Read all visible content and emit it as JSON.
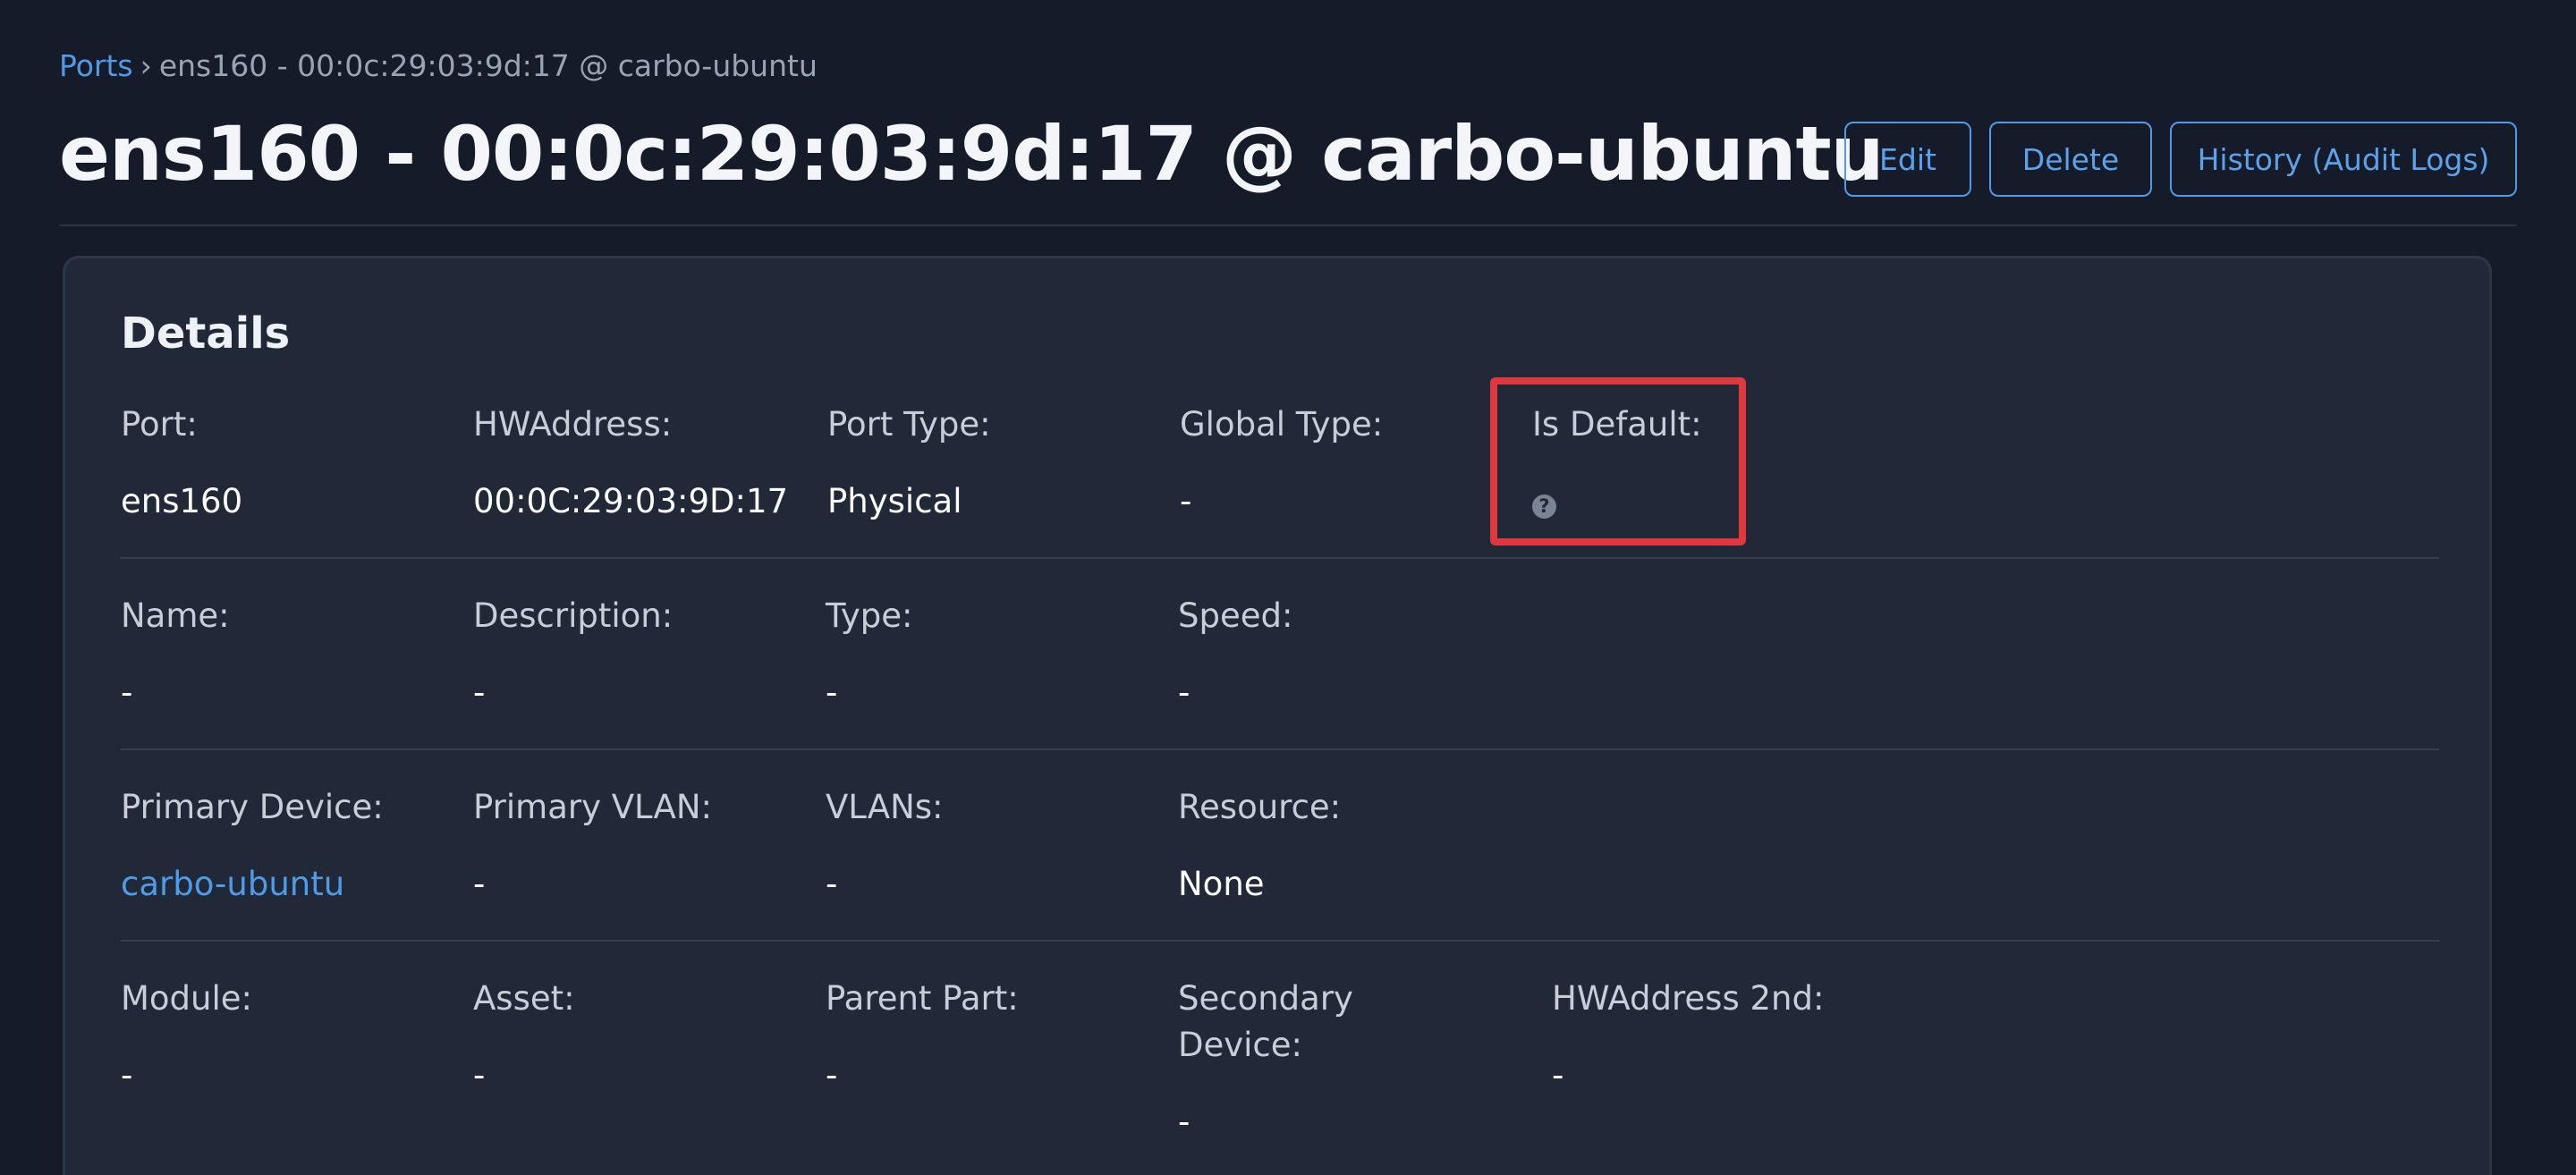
{
  "breadcrumb": {
    "link": "Ports",
    "separator": "›",
    "current": "ens160 - 00:0c:29:03:9d:17 @ carbo-ubuntu"
  },
  "page": {
    "title": "ens160 - 00:0c:29:03:9d:17 @ carbo-ubuntu"
  },
  "actions": {
    "edit": "Edit",
    "delete": "Delete",
    "history": "History (Audit Logs)"
  },
  "details": {
    "title": "Details",
    "row1": {
      "port_label": "Port:",
      "port_value": "ens160",
      "hw_label": "HWAddress:",
      "hw_value": "00:0C:29:03:9D:17",
      "port_type_label": "Port Type:",
      "port_type_value": "Physical",
      "global_type_label": "Global Type:",
      "global_type_value": "-",
      "is_default_label": "Is Default:",
      "is_default_icon": "?"
    },
    "row2": {
      "name_label": "Name:",
      "name_value": "-",
      "description_label": "Description:",
      "description_value": "-",
      "type_label": "Type:",
      "type_value": "-",
      "speed_label": "Speed:",
      "speed_value": "-"
    },
    "row3": {
      "primary_device_label": "Primary Device:",
      "primary_device_value": "carbo-ubuntu",
      "primary_vlan_label": "Primary VLAN:",
      "primary_vlan_value": "-",
      "vlans_label": "VLANs:",
      "vlans_value": "-",
      "resource_label": "Resource:",
      "resource_value": "None"
    },
    "row4": {
      "module_label": "Module:",
      "module_value": "-",
      "asset_label": "Asset:",
      "asset_value": "-",
      "parent_part_label": "Parent Part:",
      "parent_part_value": "-",
      "secondary_device_label": "Secondary Device:",
      "secondary_device_value": "-",
      "hw2_label": "HWAddress 2nd:",
      "hw2_value": "-"
    }
  },
  "colors": {
    "background": "#151b28",
    "card": "#212938",
    "accent": "#4f9be8",
    "highlight": "#e0383f"
  }
}
